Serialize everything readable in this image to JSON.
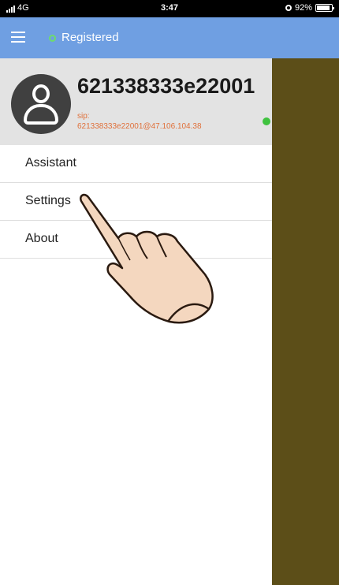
{
  "status_bar": {
    "signal": "4G",
    "time": "3:47",
    "battery_text": "92%",
    "battery_percent": 92
  },
  "header": {
    "menu_icon": "hamburger-icon",
    "status_icon": "status-ring-icon",
    "status_text": "Registered",
    "accent_color": "#6f9fe2",
    "status_color": "#6ddc6d"
  },
  "drawer": {
    "profile": {
      "avatar_icon": "person-icon",
      "username": "621338333e22001",
      "sip_label": "sip:",
      "sip_address": "621338333e22001@47.106.104.38",
      "presence_color": "#3fc23f"
    },
    "items": [
      {
        "label": "Assistant"
      },
      {
        "label": "Settings"
      },
      {
        "label": "About"
      }
    ]
  }
}
